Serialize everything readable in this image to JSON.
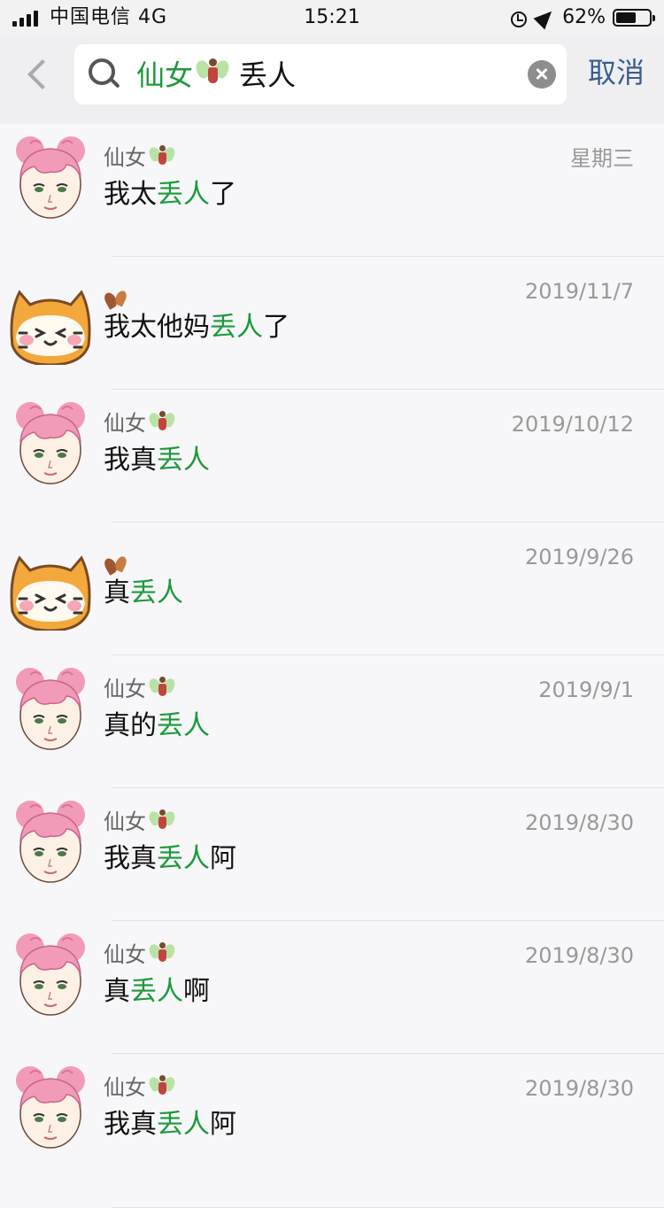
{
  "status_bar": {
    "carrier": "中国电信 4G",
    "time": "15:21",
    "battery": "62%",
    "battery_level": 0.62
  },
  "search": {
    "query_token": "仙女",
    "query_token_icon": "fairy-emoji",
    "query_rest": "丢人",
    "cancel_label": "取消"
  },
  "results": [
    {
      "sender": "仙女",
      "sender_icon": "fairy-emoji",
      "avatar": "pink-hair-girl",
      "date": "星期三",
      "msg_before": "我太",
      "msg_highlight": "丢人",
      "msg_after": "了"
    },
    {
      "sender": "",
      "sender_icon": "leaf-emoji",
      "avatar": "orange-cat",
      "date": "2019/11/7",
      "msg_before": "我太他妈",
      "msg_highlight": "丢人",
      "msg_after": "了"
    },
    {
      "sender": "仙女",
      "sender_icon": "fairy-emoji",
      "avatar": "pink-hair-girl",
      "date": "2019/10/12",
      "msg_before": "我真",
      "msg_highlight": "丢人",
      "msg_after": ""
    },
    {
      "sender": "",
      "sender_icon": "leaf-emoji",
      "avatar": "orange-cat",
      "date": "2019/9/26",
      "msg_before": "真",
      "msg_highlight": "丢人",
      "msg_after": ""
    },
    {
      "sender": "仙女",
      "sender_icon": "fairy-emoji",
      "avatar": "pink-hair-girl",
      "date": "2019/9/1",
      "msg_before": "真的",
      "msg_highlight": "丢人",
      "msg_after": ""
    },
    {
      "sender": "仙女",
      "sender_icon": "fairy-emoji",
      "avatar": "pink-hair-girl",
      "date": "2019/8/30",
      "msg_before": "我真",
      "msg_highlight": "丢人",
      "msg_after": "阿"
    },
    {
      "sender": "仙女",
      "sender_icon": "fairy-emoji",
      "avatar": "pink-hair-girl",
      "date": "2019/8/30",
      "msg_before": "真",
      "msg_highlight": "丢人",
      "msg_after": "啊"
    },
    {
      "sender": "仙女",
      "sender_icon": "fairy-emoji",
      "avatar": "pink-hair-girl",
      "date": "2019/8/30",
      "msg_before": "我真",
      "msg_highlight": "丢人",
      "msg_after": "阿"
    }
  ],
  "colors": {
    "highlight": "#1a9a3a",
    "cancel": "#3b5d8f",
    "background": "#f7f6f8"
  }
}
